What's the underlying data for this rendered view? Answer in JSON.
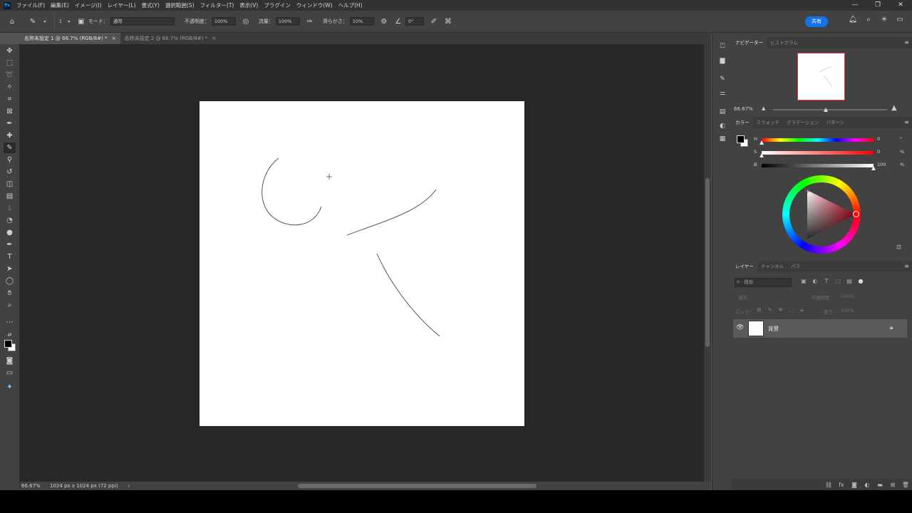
{
  "menubar": {
    "items": [
      "ファイル(F)",
      "編集(E)",
      "イメージ(I)",
      "レイヤー(L)",
      "書式(Y)",
      "選択範囲(S)",
      "フィルター(T)",
      "表示(V)",
      "プラグイン",
      "ウィンドウ(W)",
      "ヘルプ(H)"
    ],
    "logo": "Ps"
  },
  "window_controls": {
    "minimize": "—",
    "restore": "❐",
    "close": "✕"
  },
  "options_bar": {
    "mode_label": "モード：",
    "mode_value": "通常",
    "opacity_label": "不透明度：",
    "opacity_value": "100%",
    "flow_label": "流量：",
    "flow_value": "100%",
    "smoothing_label": "滑らかさ：",
    "smoothing_value": "10%",
    "angle_value": "0°",
    "brush_size": "1"
  },
  "share_button": "共有",
  "document_tabs": [
    {
      "label": "名称未設定 1 @ 66.7% (RGB/8#) *",
      "close": "×",
      "active": true
    },
    {
      "label": "名称未設定 2 @ 66.7% (RGB/8#) *",
      "close": "×",
      "active": false
    }
  ],
  "status_bar": {
    "zoom": "66.67%",
    "doc_info": "1024 px x 1024 px (72 ppi)",
    "arrow": "›"
  },
  "navigator": {
    "tabs": [
      "ナビゲーター",
      "ヒストグラム"
    ],
    "zoom": "66.67%"
  },
  "color_panel": {
    "tabs": [
      "カラー",
      "スウォッチ",
      "グラデーション",
      "パターン"
    ],
    "sliders": [
      {
        "label": "H",
        "value": "0",
        "unit": "°",
        "fraction": 0.0
      },
      {
        "label": "S",
        "value": "0",
        "unit": "%",
        "fraction": 0.0
      },
      {
        "label": "B",
        "value": "100",
        "unit": "%",
        "fraction": 1.0
      }
    ]
  },
  "layers_panel": {
    "tabs": [
      "レイヤー",
      "チャンネル",
      "パス"
    ],
    "search_placeholder": "種類",
    "blend_mode": "通常",
    "opacity_label": "不透明度：",
    "opacity_value": "100%",
    "lock_label": "ロック：",
    "fill_label": "塗り：",
    "fill_value": "100%",
    "layers": [
      {
        "name": "背景",
        "visible": true,
        "locked": true
      }
    ]
  },
  "colors": {
    "accent": "#1473e6",
    "panel_bg": "#424242",
    "workspace_bg": "#282828",
    "canvas": "#ffffff"
  }
}
